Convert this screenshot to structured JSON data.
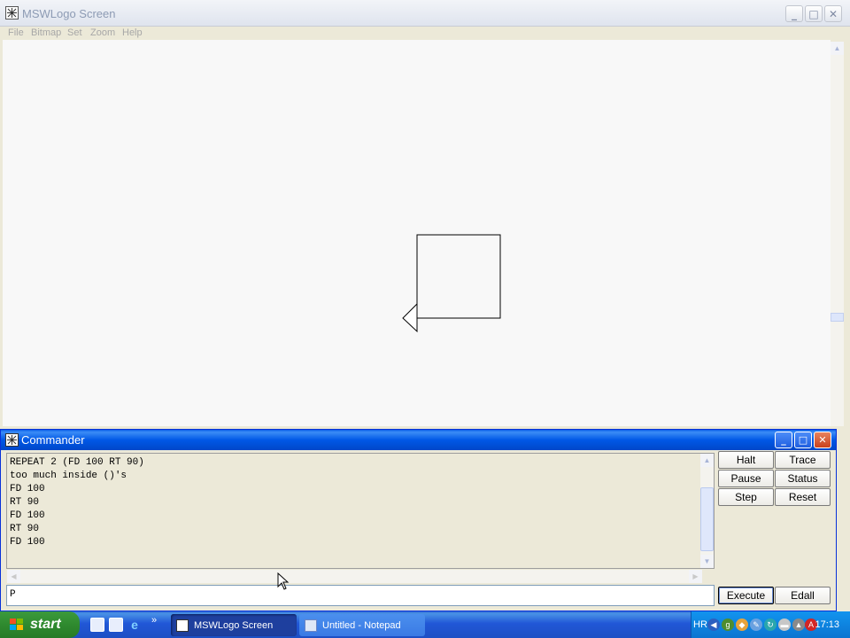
{
  "main_window": {
    "title": "MSWLogo Screen",
    "controls": {
      "minimize": "_",
      "maximize": "□",
      "close": "✕"
    },
    "menu": [
      "File",
      "Bitmap",
      "Set",
      "Zoom",
      "Help"
    ],
    "scroll": {
      "up": "▲",
      "down": "▼"
    }
  },
  "commander": {
    "title": "Commander",
    "controls": {
      "minimize": "_",
      "maximize": "□",
      "close": "✕"
    },
    "output": "REPEAT 2 (FD 100 RT 90)\ntoo much inside ()'s\nFD 100\nRT 90\nFD 100\nRT 90\nFD 100",
    "input_value": "P",
    "scroll": {
      "up": "▲",
      "down": "▼",
      "left": "◀",
      "right": "▶"
    },
    "buttons": {
      "halt": "Halt",
      "trace": "Trace",
      "pause": "Pause",
      "status": "Status",
      "step": "Step",
      "reset": "Reset",
      "execute": "Execute",
      "edall": "Edall"
    }
  },
  "taskbar": {
    "start_label": "start",
    "more_glyph": "»",
    "tasks": [
      {
        "label": "MSWLogo Screen",
        "active": true
      },
      {
        "label": "Untitled - Notepad",
        "active": false
      }
    ],
    "tray": {
      "language": "HR",
      "clock": "17:13"
    }
  }
}
